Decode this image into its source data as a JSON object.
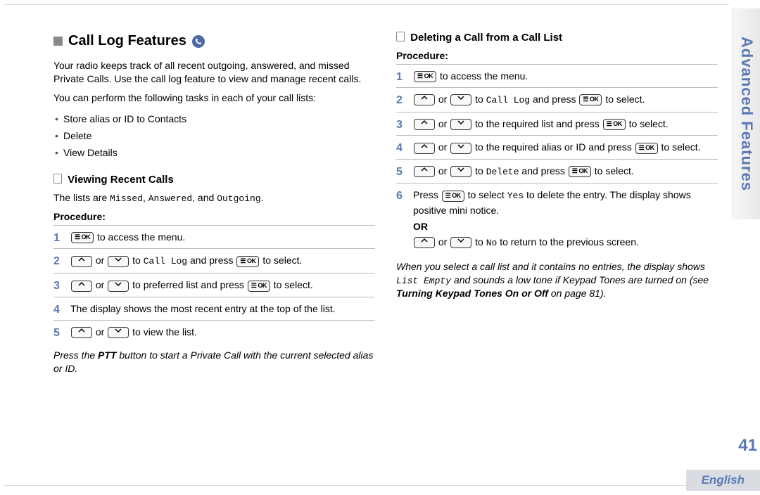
{
  "sideTab": "Advanced Features",
  "pageNumber": "41",
  "language": "English",
  "heading": "Call Log Features",
  "intro1": "Your radio keeps track of all recent outgoing, answered, and missed Private Calls. Use the call log feature to view and manage recent calls.",
  "intro2": "You can perform the following tasks in each of your call lists:",
  "tasks": [
    "Store alias or ID to Contacts",
    "Delete",
    "View Details"
  ],
  "sub1": "Viewing Recent Calls",
  "listsLine_pre": "The lists are ",
  "listsLine_m1": "Missed",
  "listsLine_sep1": ", ",
  "listsLine_m2": "Answered",
  "listsLine_sep2": ", and ",
  "listsLine_m3": "Outgoing",
  "listsLine_post": ".",
  "procedureLabel": "Procedure:",
  "v_step1": " to access the menu.",
  "v_step2a": " or ",
  "v_step2b": " to ",
  "v_step2c": "Call Log",
  "v_step2d": " and press ",
  "v_step2e": " to select.",
  "v_step3a": " or ",
  "v_step3b": " to preferred list and press ",
  "v_step3c": " to select.",
  "v_step4": "The display shows the most recent entry at the top of the list.",
  "v_step5a": " or ",
  "v_step5b": " to view the list.",
  "v_note_pre": "Press the ",
  "v_note_b": "PTT",
  "v_note_post": " button to start a Private Call with the current selected alias or ID.",
  "sub2": "Deleting a Call from a Call List",
  "d_step1": " to access the menu.",
  "d_step2a": " or ",
  "d_step2b": " to ",
  "d_step2c": "Call Log",
  "d_step2d": " and press ",
  "d_step2e": " to select.",
  "d_step3a": " or ",
  "d_step3b": " to the required list and press ",
  "d_step3c": " to select.",
  "d_step4a": " or ",
  "d_step4b": " to the required alias or ID and press ",
  "d_step4c": " to select.",
  "d_step5a": " or ",
  "d_step5b": " to ",
  "d_step5c": "Delete",
  "d_step5d": " and press ",
  "d_step5e": " to select.",
  "d_step6a": "Press ",
  "d_step6b": " to select ",
  "d_step6c": "Yes",
  "d_step6d": " to delete the entry. The display shows positive mini notice.",
  "orLabel": "OR",
  "d_or_a": " or ",
  "d_or_b": " to ",
  "d_or_c": "No",
  "d_or_d": " to return to the previous screen.",
  "d_note_pre": "When you select a call list and it contains no entries, the display shows ",
  "d_note_mono": "List Empty",
  "d_note_mid": " and sounds a low tone if Keypad Tones are turned on (see ",
  "d_note_b": "Turning Keypad Tones On or Off",
  "d_note_post": " on page 81).",
  "okBtn": "☰ OK"
}
